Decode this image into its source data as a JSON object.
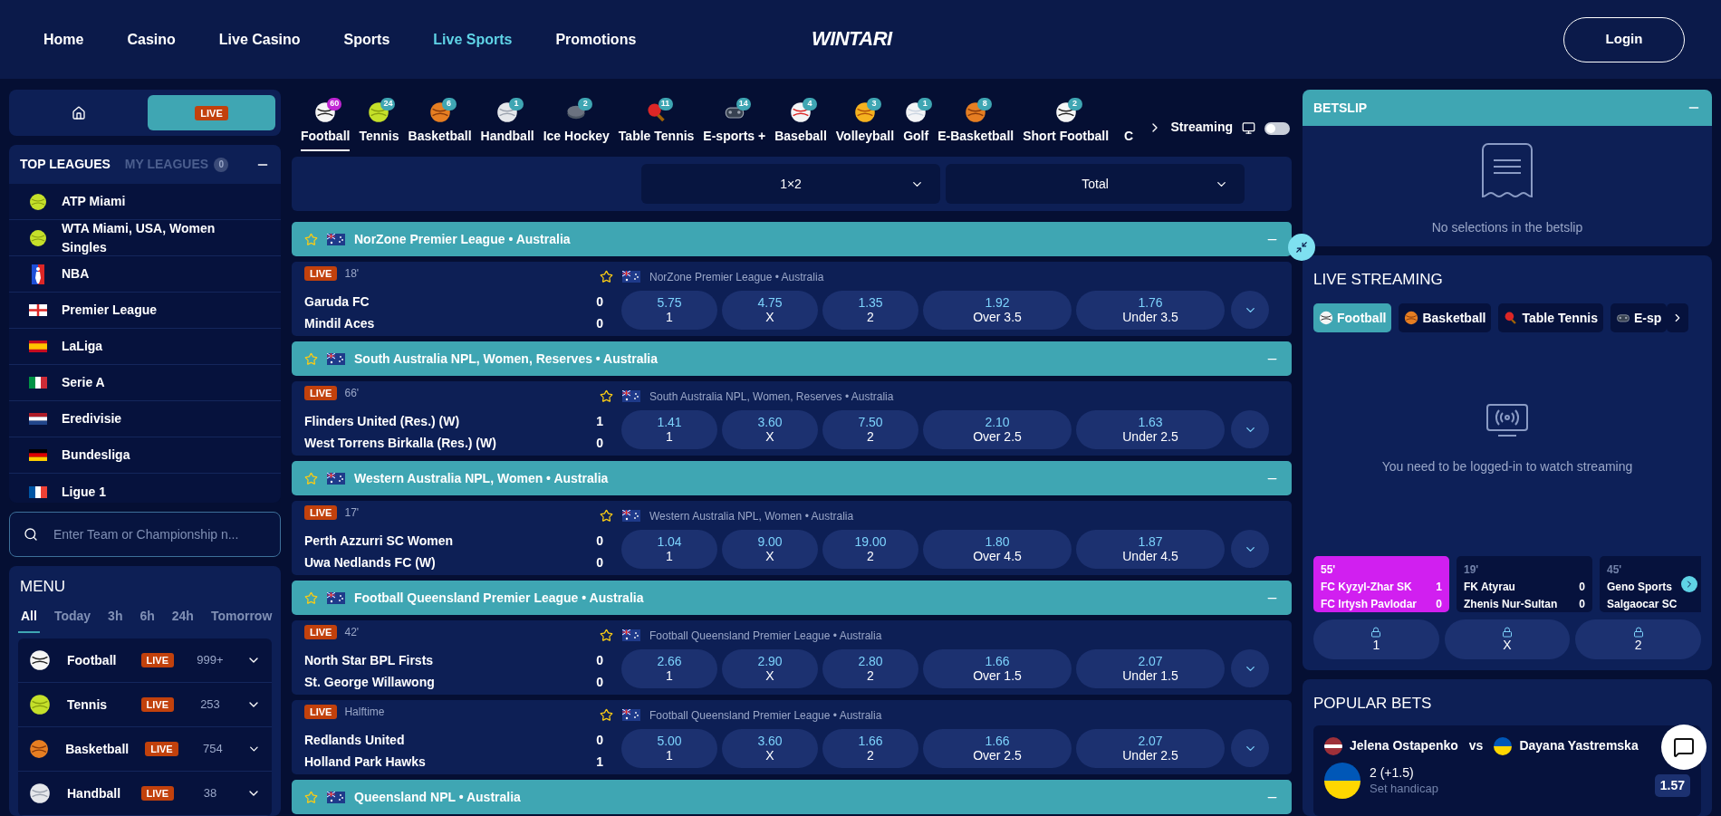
{
  "nav": {
    "items": [
      {
        "label": "Home",
        "selected": false
      },
      {
        "label": "Casino",
        "selected": false
      },
      {
        "label": "Live Casino",
        "selected": false
      },
      {
        "label": "Sports",
        "selected": false
      },
      {
        "label": "Live Sports",
        "selected": true
      },
      {
        "label": "Promotions",
        "selected": false
      }
    ],
    "logo": "WINTARI",
    "login": "Login"
  },
  "sidebar": {
    "view_tabs": [
      {
        "kind": "home",
        "selected": false
      },
      {
        "kind": "live",
        "label": "LIVE",
        "selected": true
      }
    ],
    "league_tabs": [
      {
        "label": "TOP LEAGUES",
        "selected": true
      },
      {
        "label": "MY LEAGUES",
        "count": "0",
        "selected": false
      }
    ],
    "top_leagues": [
      {
        "name": "ATP Miami",
        "kind": "tennis"
      },
      {
        "name": "WTA Miami, USA, Women Singles",
        "kind": "tennis"
      },
      {
        "name": "NBA",
        "kind": "nba"
      },
      {
        "name": "Premier League",
        "kind": "eng"
      },
      {
        "name": "LaLiga",
        "kind": "es"
      },
      {
        "name": "Serie A",
        "kind": "it"
      },
      {
        "name": "Eredivisie",
        "kind": "nl"
      },
      {
        "name": "Bundesliga",
        "kind": "de"
      },
      {
        "name": "Ligue 1",
        "kind": "fr"
      }
    ],
    "search": {
      "placeholder": "Enter Team or Championship n..."
    },
    "menu": {
      "title": "MENU",
      "filters": [
        {
          "label": "All",
          "selected": true
        },
        {
          "label": "Today",
          "selected": false
        },
        {
          "label": "3h",
          "selected": false
        },
        {
          "label": "6h",
          "selected": false
        },
        {
          "label": "24h",
          "selected": false
        },
        {
          "label": "Tomorrow",
          "selected": false
        }
      ],
      "sports": [
        {
          "name": "Football",
          "kind": "football",
          "badge": "LIVE",
          "count": "999+"
        },
        {
          "name": "Tennis",
          "kind": "tennis",
          "badge": "LIVE",
          "count": "253"
        },
        {
          "name": "Basketball",
          "kind": "basketball",
          "badge": "LIVE",
          "count": "754"
        },
        {
          "name": "Handball",
          "kind": "handball",
          "badge": "LIVE",
          "count": "38"
        }
      ]
    }
  },
  "sports_bar": {
    "items": [
      {
        "name": "Football",
        "kind": "football",
        "count": "60",
        "selected": true
      },
      {
        "name": "Tennis",
        "kind": "tennis",
        "count": "24",
        "selected": false
      },
      {
        "name": "Basketball",
        "kind": "basketball",
        "count": "6",
        "selected": false
      },
      {
        "name": "Handball",
        "kind": "handball",
        "count": "1",
        "selected": false
      },
      {
        "name": "Ice Hockey",
        "kind": "hockey",
        "count": "2",
        "selected": false
      },
      {
        "name": "Table Tennis",
        "kind": "tabletennis",
        "count": "11",
        "selected": false
      },
      {
        "name": "E-sports +",
        "kind": "esports",
        "count": "14",
        "selected": false
      },
      {
        "name": "Baseball",
        "kind": "baseball",
        "count": "4",
        "selected": false
      },
      {
        "name": "Volleyball",
        "kind": "volleyball",
        "count": "3",
        "selected": false
      },
      {
        "name": "Golf",
        "kind": "golf",
        "count": "1",
        "selected": false
      },
      {
        "name": "E-Basketball",
        "kind": "basketball",
        "count": "8",
        "selected": false
      },
      {
        "name": "Short Football",
        "kind": "football",
        "count": "2",
        "selected": false
      },
      {
        "name": "C",
        "kind": "none",
        "selected": false
      }
    ],
    "streaming_label": "Streaming",
    "streaming_on": false
  },
  "markets": [
    "1×2",
    "Total"
  ],
  "groups": [
    {
      "title": "NorZone Premier League • Australia",
      "matches": [
        {
          "status": "LIVE",
          "time": "18'",
          "league": "NorZone Premier League • Australia",
          "home": "Garuda FC",
          "away": "Mindil Aces",
          "home_score": "0",
          "away_score": "0",
          "odds": [
            {
              "value": "5.75",
              "label": "1"
            },
            {
              "value": "4.75",
              "label": "X"
            },
            {
              "value": "1.35",
              "label": "2"
            },
            {
              "value": "1.92",
              "label": "Over 3.5"
            },
            {
              "value": "1.76",
              "label": "Under 3.5"
            }
          ]
        }
      ]
    },
    {
      "title": "South Australia NPL, Women, Reserves • Australia",
      "matches": [
        {
          "status": "LIVE",
          "time": "66'",
          "league": "South Australia NPL, Women, Reserves • Australia",
          "home": "Flinders United (Res.) (W)",
          "away": "West Torrens Birkalla (Res.) (W)",
          "home_score": "1",
          "away_score": "0",
          "odds": [
            {
              "value": "1.41",
              "label": "1"
            },
            {
              "value": "3.60",
              "label": "X"
            },
            {
              "value": "7.50",
              "label": "2"
            },
            {
              "value": "2.10",
              "label": "Over 2.5"
            },
            {
              "value": "1.63",
              "label": "Under 2.5"
            }
          ]
        }
      ]
    },
    {
      "title": "Western Australia NPL, Women • Australia",
      "matches": [
        {
          "status": "LIVE",
          "time": "17'",
          "league": "Western Australia NPL, Women • Australia",
          "home": "Perth Azzurri SC Women",
          "away": "Uwa Nedlands FC (W)",
          "home_score": "0",
          "away_score": "0",
          "odds": [
            {
              "value": "1.04",
              "label": "1"
            },
            {
              "value": "9.00",
              "label": "X"
            },
            {
              "value": "19.00",
              "label": "2"
            },
            {
              "value": "1.80",
              "label": "Over 4.5"
            },
            {
              "value": "1.87",
              "label": "Under 4.5"
            }
          ]
        }
      ]
    },
    {
      "title": "Football Queensland Premier League • Australia",
      "matches": [
        {
          "status": "LIVE",
          "time": "42'",
          "league": "Football Queensland Premier League • Australia",
          "home": "North Star BPL Firsts",
          "away": "St. George Willawong",
          "home_score": "0",
          "away_score": "0",
          "odds": [
            {
              "value": "2.66",
              "label": "1"
            },
            {
              "value": "2.90",
              "label": "X"
            },
            {
              "value": "2.80",
              "label": "2"
            },
            {
              "value": "1.66",
              "label": "Over 1.5"
            },
            {
              "value": "2.07",
              "label": "Under 1.5"
            }
          ]
        },
        {
          "status": "LIVE",
          "time": "Halftime",
          "league": "Football Queensland Premier League • Australia",
          "home": "Redlands United",
          "away": "Holland Park Hawks",
          "home_score": "0",
          "away_score": "1",
          "odds": [
            {
              "value": "5.00",
              "label": "1"
            },
            {
              "value": "3.60",
              "label": "X"
            },
            {
              "value": "1.66",
              "label": "2"
            },
            {
              "value": "1.66",
              "label": "Over 2.5"
            },
            {
              "value": "2.07",
              "label": "Under 2.5"
            }
          ]
        }
      ]
    },
    {
      "title": "Queensland NPL • Australia"
    }
  ],
  "betslip": {
    "title": "BETSLIP",
    "empty": "No selections in the betslip"
  },
  "live_streaming": {
    "title": "LIVE STREAMING",
    "tabs": [
      {
        "label": "Football",
        "kind": "football",
        "selected": true
      },
      {
        "label": "Basketball",
        "kind": "basketball",
        "selected": false
      },
      {
        "label": "Table Tennis",
        "kind": "tabletennis",
        "selected": false
      },
      {
        "label": "E-sp",
        "kind": "esports",
        "selected": false
      }
    ],
    "message": "You need to be logged-in to watch streaming",
    "cards": [
      {
        "time": "55'",
        "home": "FC Kyzyl-Zhar SK",
        "away": "FC Irtysh Pavlodar",
        "home_score": "1",
        "away_score": "0",
        "selected": true
      },
      {
        "time": "19'",
        "home": "FK Atyrau",
        "away": "Zhenis Nur-Sultan",
        "home_score": "0",
        "away_score": "0",
        "selected": false
      },
      {
        "time": "45'",
        "home": "Geno Sports",
        "away": "Salgaocar SC",
        "selected": false
      }
    ],
    "outcomes": [
      "1",
      "X",
      "2"
    ]
  },
  "popular_bets": {
    "title": "POPULAR BETS",
    "player1": "Jelena Ostapenko",
    "vs": "vs",
    "player2": "Dayana Yastremska",
    "bet": "2 (+1.5)",
    "sub": "Set handicap",
    "odds": "1.57"
  }
}
